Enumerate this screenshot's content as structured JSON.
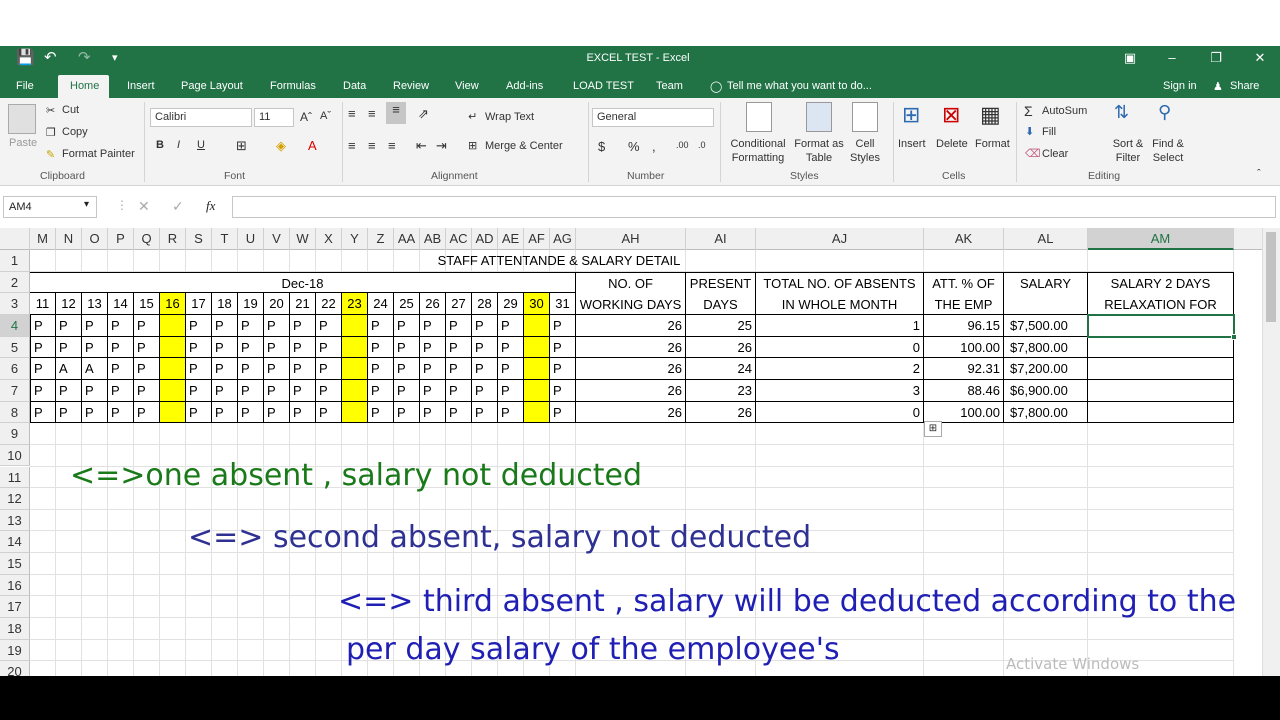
{
  "window": {
    "title": "EXCEL TEST - Excel"
  },
  "tabs": [
    "File",
    "Home",
    "Insert",
    "Page Layout",
    "Formulas",
    "Data",
    "Review",
    "View",
    "Add-ins",
    "LOAD TEST",
    "Team"
  ],
  "tell_me": "Tell me what you want to do...",
  "sign_in": "Sign in",
  "share": "Share",
  "ribbon": {
    "clipboard": {
      "paste": "Paste",
      "cut": "Cut",
      "copy": "Copy",
      "format_painter": "Format Painter",
      "label": "Clipboard"
    },
    "font": {
      "name": "Calibri",
      "size": "11",
      "bold": "B",
      "italic": "I",
      "underline": "U",
      "label": "Font"
    },
    "alignment": {
      "wrap": "Wrap Text",
      "merge": "Merge & Center",
      "label": "Alignment"
    },
    "number": {
      "format": "General",
      "label": "Number"
    },
    "styles": {
      "conditional": "Conditional Formatting",
      "format_as": "Format as Table",
      "cell_styles": "Cell Styles",
      "label": "Styles"
    },
    "cells": {
      "insert": "Insert",
      "delete": "Delete",
      "format": "Format",
      "label": "Cells"
    },
    "editing": {
      "autosum": "AutoSum",
      "fill": "Fill",
      "clear": "Clear",
      "sort": "Sort & Filter",
      "find": "Find & Select",
      "label": "Editing"
    }
  },
  "name_box": "AM4",
  "columns": [
    "M",
    "N",
    "O",
    "P",
    "Q",
    "R",
    "S",
    "T",
    "U",
    "V",
    "W",
    "X",
    "Y",
    "Z",
    "AA",
    "AB",
    "AC",
    "AD",
    "AE",
    "AF",
    "AG",
    "AH",
    "AI",
    "AJ",
    "AK",
    "AL",
    "AM"
  ],
  "rows": [
    "1",
    "2",
    "3",
    "4",
    "5",
    "6",
    "7",
    "8",
    "9",
    "10",
    "11",
    "12",
    "13",
    "14",
    "15",
    "16",
    "17",
    "18",
    "19",
    "20"
  ],
  "sheet": {
    "title": "STAFF ATTENTANDE & SALARY DETAIL",
    "month": "Dec-18",
    "days": [
      "11",
      "12",
      "13",
      "14",
      "15",
      "16",
      "17",
      "18",
      "19",
      "20",
      "21",
      "22",
      "23",
      "24",
      "25",
      "26",
      "27",
      "28",
      "29",
      "30",
      "31"
    ],
    "headers": {
      "working_days": [
        "NO. OF",
        "WORKING DAYS"
      ],
      "present_days": [
        "PRESENT",
        "DAYS"
      ],
      "absents": [
        "TOTAL NO. OF ABSENTS",
        "IN WHOLE MONTH"
      ],
      "att_pct": [
        "ATT. % OF",
        "THE EMP"
      ],
      "salary": "SALARY",
      "relax": [
        "SALARY 2 DAYS",
        "RELAXATION FOR"
      ]
    },
    "attendance": [
      [
        "P",
        "P",
        "P",
        "P",
        "P",
        "",
        "P",
        "P",
        "P",
        "P",
        "P",
        "P",
        "",
        "P",
        "P",
        "P",
        "P",
        "P",
        "P",
        "",
        "P"
      ],
      [
        "P",
        "P",
        "P",
        "P",
        "P",
        "",
        "P",
        "P",
        "P",
        "P",
        "P",
        "P",
        "",
        "P",
        "P",
        "P",
        "P",
        "P",
        "P",
        "",
        "P"
      ],
      [
        "P",
        "A",
        "A",
        "P",
        "P",
        "",
        "P",
        "P",
        "P",
        "P",
        "P",
        "P",
        "",
        "P",
        "P",
        "P",
        "P",
        "P",
        "P",
        "",
        "P"
      ],
      [
        "P",
        "P",
        "P",
        "P",
        "P",
        "",
        "P",
        "P",
        "P",
        "P",
        "P",
        "P",
        "",
        "P",
        "P",
        "P",
        "P",
        "P",
        "P",
        "",
        "P"
      ],
      [
        "P",
        "P",
        "P",
        "P",
        "P",
        "",
        "P",
        "P",
        "P",
        "P",
        "P",
        "P",
        "",
        "P",
        "P",
        "P",
        "P",
        "P",
        "P",
        "",
        "P"
      ]
    ],
    "records": [
      {
        "working": "26",
        "present": "25",
        "absent": "1",
        "pct": "96.15",
        "salary": "$7,500.00"
      },
      {
        "working": "26",
        "present": "26",
        "absent": "0",
        "pct": "100.00",
        "salary": "$7,800.00"
      },
      {
        "working": "26",
        "present": "24",
        "absent": "2",
        "pct": "92.31",
        "salary": "$7,200.00"
      },
      {
        "working": "26",
        "present": "23",
        "absent": "3",
        "pct": "88.46",
        "salary": "$6,900.00"
      },
      {
        "working": "26",
        "present": "26",
        "absent": "0",
        "pct": "100.00",
        "salary": "$7,800.00"
      }
    ]
  },
  "notes": [
    "<=>one absent , salary not deducted",
    "<=> second absent, salary not deducted",
    "<=> third absent , salary will be deducted according to the",
    "per day salary of the employee's"
  ],
  "watermark": "Activate Windows",
  "colors": {
    "excel_green": "#217346",
    "holiday": "#ffff00",
    "note_green": "#1a7a1a",
    "note_navy": "#2e3192",
    "note_blue": "#1f1fb4"
  }
}
